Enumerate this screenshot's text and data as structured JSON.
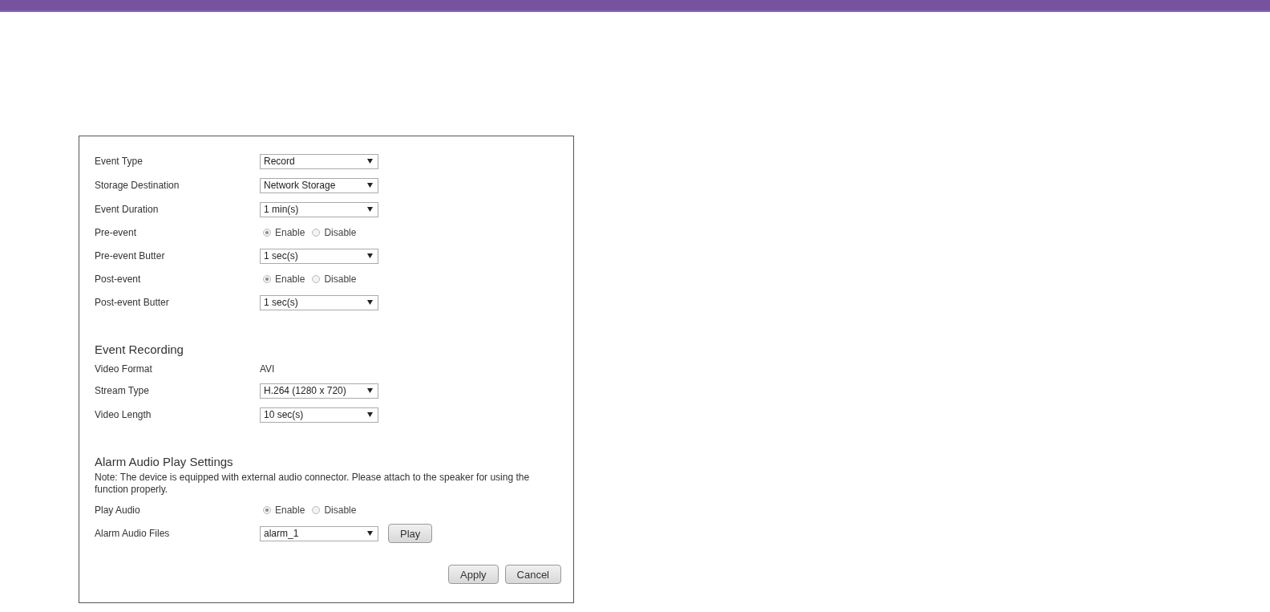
{
  "sections": [
    {
      "rows": [
        {
          "kind": "select",
          "label": "Event Type",
          "value": "Record"
        },
        {
          "kind": "select",
          "label": "Storage Destination",
          "value": "Network Storage"
        },
        {
          "kind": "select",
          "label": "Event Duration",
          "value": "1 min(s)"
        },
        {
          "kind": "radio",
          "label": "Pre-event",
          "options": [
            {
              "label": "Enable",
              "selected": true
            },
            {
              "label": "Disable",
              "selected": false
            }
          ]
        },
        {
          "kind": "select",
          "label": "Pre-event Butter",
          "value": "1 sec(s)"
        },
        {
          "kind": "radio",
          "label": "Post-event",
          "options": [
            {
              "label": "Enable",
              "selected": true
            },
            {
              "label": "Disable",
              "selected": false
            }
          ]
        },
        {
          "kind": "select",
          "label": "Post-event Butter",
          "value": "1 sec(s)"
        }
      ]
    },
    {
      "heading": "Event Recording",
      "rows": [
        {
          "kind": "text",
          "label": "Video Format",
          "value": "AVI"
        },
        {
          "kind": "select",
          "label": "Stream Type",
          "value": "H.264 (1280 x 720)"
        },
        {
          "kind": "select",
          "label": "Video Length",
          "value": "10 sec(s)"
        }
      ]
    },
    {
      "heading": "Alarm Audio Play Settings",
      "note": "Note: The device is equipped with external audio connector. Please attach to the speaker for using the function properly.",
      "rows": [
        {
          "kind": "radio",
          "label": "Play Audio",
          "options": [
            {
              "label": "Enable",
              "selected": true
            },
            {
              "label": "Disable",
              "selected": false
            }
          ]
        },
        {
          "kind": "select",
          "label": "Alarm Audio Files",
          "value": "alarm_1",
          "button": "Play"
        }
      ]
    }
  ],
  "buttons": [
    "Apply",
    "Cancel"
  ]
}
